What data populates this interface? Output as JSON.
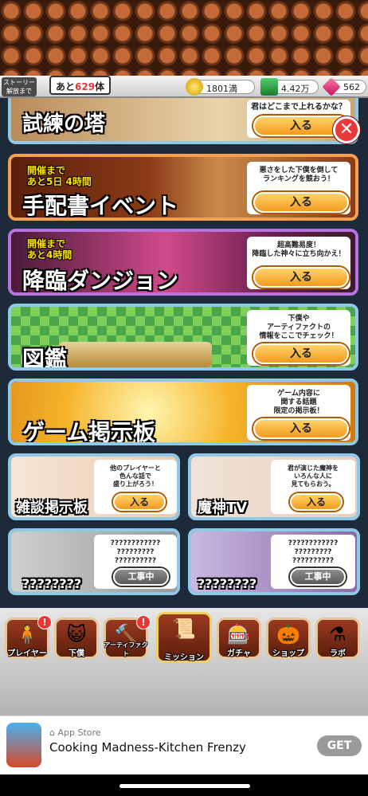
{
  "header": {
    "story_unlock": "ストーリー\n解放まで",
    "remaining_prefix": "あと",
    "remaining_count": "629",
    "remaining_suffix": "体",
    "coins": "1801満",
    "xp": "4.42万",
    "gems": "562"
  },
  "cards": {
    "tower": {
      "title": "試練の塔",
      "desc": "君はどこまで上れるかな？",
      "button": "入る"
    },
    "wanted": {
      "badge_line1": "開催まで",
      "badge_line2": "あと5日 4時間",
      "title": "手配書イベント",
      "desc": "悪さをした下僕を倒して\nランキングを競おう！",
      "button": "入る"
    },
    "dungeon": {
      "badge_line1": "開催まで",
      "badge_line2": "あと4時間",
      "title": "降臨ダンジョン",
      "desc": "超高難易度！\n降臨した神々に立ち向かえ！",
      "button": "入る"
    },
    "zukan": {
      "title": "図鑑",
      "desc": "下僕や\nアーティファクトの\n情報をここでチェック！",
      "button": "入る"
    },
    "board": {
      "title": "ゲーム掲示板",
      "desc": "ゲーム内容に\n関する話題\n限定の掲示板！",
      "button": "入る"
    },
    "chat": {
      "title": "雑談掲示板",
      "desc": "他のプレイヤーと\n色んな話で\n盛り上がろう！",
      "button": "入る"
    },
    "majin": {
      "title": "魔神TV",
      "desc": "君が演じた魔神を\nいろんな人に\n見てもらおう。",
      "button": "入る"
    },
    "unknown1": {
      "title": "????????",
      "desc": "????????????\n?????????\n??????????",
      "button": "工事中"
    },
    "unknown2": {
      "title": "????????",
      "desc": "????????????\n?????????\n??????????",
      "button": "工事中"
    }
  },
  "nav": [
    {
      "label": "プレイヤー",
      "icon": "player-icon",
      "alert": "!"
    },
    {
      "label": "下僕",
      "icon": "servant-icon",
      "alert": ""
    },
    {
      "label": "アーティファクト",
      "icon": "artifact-icon",
      "alert": "!"
    },
    {
      "label": "ミッション",
      "icon": "mission-icon",
      "alert": ""
    },
    {
      "label": "ガチャ",
      "icon": "gacha-icon",
      "alert": ""
    },
    {
      "label": "ショップ",
      "icon": "shop-icon",
      "alert": ""
    },
    {
      "label": "ラボ",
      "icon": "lab-icon",
      "alert": ""
    }
  ],
  "ad": {
    "store": "App Store",
    "name": "Cooking Madness-Kitchen Frenzy",
    "cta": "GET"
  },
  "colors": {
    "accent_orange": "#f39a1e",
    "card_border_blue": "#8fc9e6",
    "card_border_orange": "#f4a050",
    "card_border_purple": "#b873e0",
    "alert_red": "#e33333"
  }
}
